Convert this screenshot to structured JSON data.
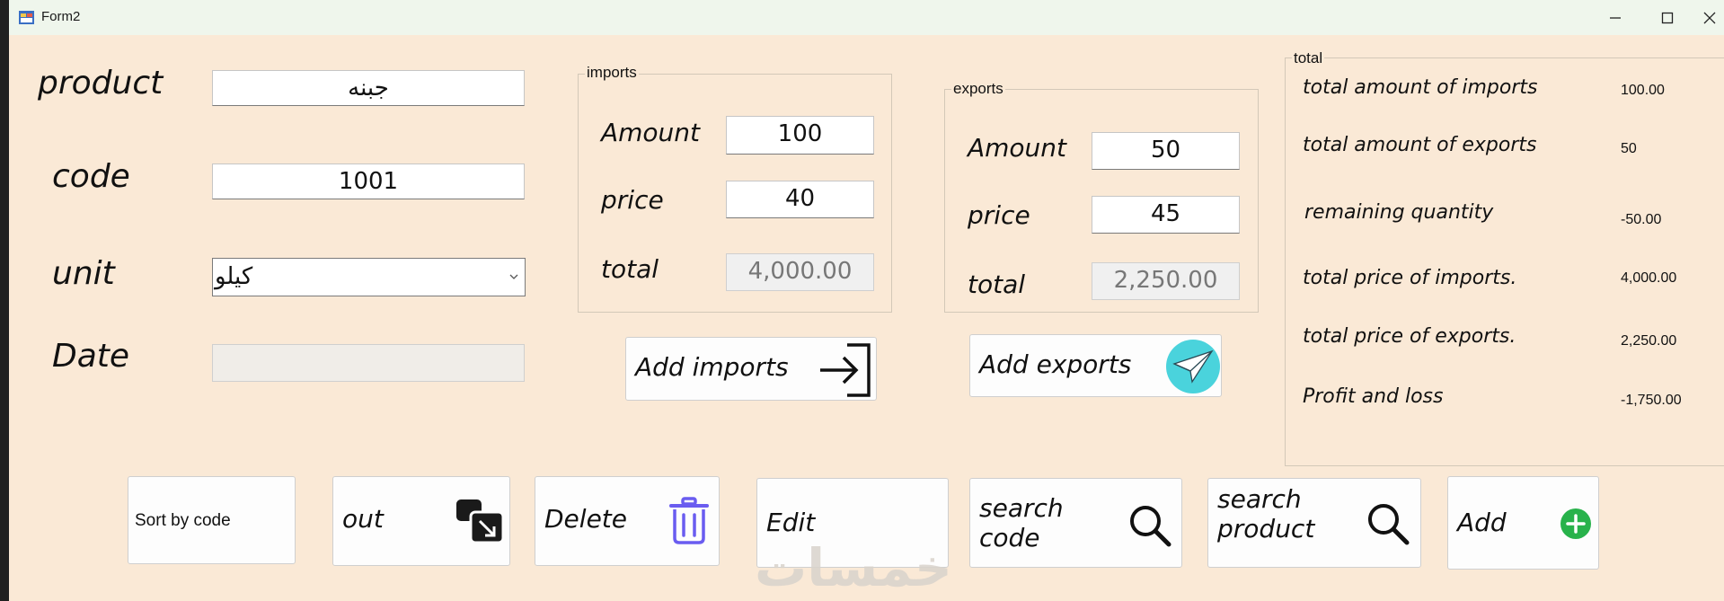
{
  "window": {
    "title": "Form2"
  },
  "form": {
    "product_label": "product",
    "product_value": "جبنه",
    "code_label": "code",
    "code_value": "1001",
    "unit_label": "unit",
    "unit_value": "كيلو",
    "date_label": "Date",
    "date_value": ""
  },
  "imports": {
    "group_title": "imports",
    "amount_label": "Amount",
    "amount_value": "100",
    "price_label": "price",
    "price_value": "40",
    "total_label": "total",
    "total_value": "4,000.00",
    "add_button": "Add imports"
  },
  "exports": {
    "group_title": "exports",
    "amount_label": "Amount",
    "amount_value": "50",
    "price_label": "price",
    "price_value": "45",
    "total_label": "total",
    "total_value": "2,250.00",
    "add_button": "Add exports"
  },
  "summary": {
    "group_title": "total",
    "rows": [
      {
        "label": "total amount of imports",
        "value": "100.00"
      },
      {
        "label": "total amount of exports",
        "value": "50"
      },
      {
        "label": "remaining quantity",
        "value": "-50.00"
      },
      {
        "label": "total price of imports.",
        "value": "4,000.00"
      },
      {
        "label": "total price of exports.",
        "value": "2,250.00"
      },
      {
        "label": "Profit and loss",
        "value": "-1,750.00"
      }
    ]
  },
  "buttons": {
    "sort_by_code": "Sort by code",
    "out": "out",
    "delete": "Delete",
    "edit": "Edit",
    "search_code_line1": "search",
    "search_code_line2": "code",
    "search_product_line1": "search",
    "search_product_line2": "product",
    "add": "Add"
  },
  "watermark": "خمسات",
  "colors": {
    "form_background": "#fae9d6",
    "titlebar": "#eff6ec",
    "delete_icon": "#6a5cf0",
    "add_icon": "#28b24b",
    "paper_plane_circle": "#4ad3dc"
  },
  "icons": [
    "app-icon",
    "minimize-icon",
    "maximize-icon",
    "close-icon",
    "chevron-down-icon",
    "enter-arrow-icon",
    "paper-plane-icon",
    "out-windows-icon",
    "trash-icon",
    "search-icon",
    "plus-circle-icon"
  ]
}
